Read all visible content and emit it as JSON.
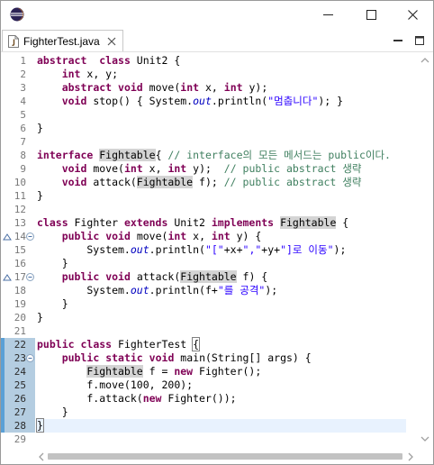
{
  "window": {
    "app_icon": "eclipse-logo-icon",
    "controls": [
      "minimize-icon",
      "maximize-icon",
      "close-icon"
    ]
  },
  "editor_tab": {
    "filename": "FighterTest.java",
    "icon": "java-file-icon",
    "close_icon": "close-icon",
    "right_controls": [
      "minimize-icon",
      "maximize-icon"
    ]
  },
  "colors": {
    "keyword": "#7f0055",
    "comment": "#3f7f5f",
    "string": "#2a00ff",
    "static_field": "#0000c0",
    "occurrence_highlight": "#d4d4d4",
    "current_line": "#e8f2fe",
    "change_ruler": "#b4cde1"
  },
  "lines": [
    {
      "n": "1",
      "tokens": [
        [
          "kw",
          "abstract"
        ],
        [
          "",
          "  "
        ],
        [
          "kw",
          "class"
        ],
        [
          "",
          " Unit2 {"
        ]
      ]
    },
    {
      "n": "2",
      "tokens": [
        [
          "",
          "    "
        ],
        [
          "kw",
          "int"
        ],
        [
          "",
          " x, y;"
        ]
      ]
    },
    {
      "n": "3",
      "tokens": [
        [
          "",
          "    "
        ],
        [
          "kw",
          "abstract"
        ],
        [
          "",
          " "
        ],
        [
          "kw",
          "void"
        ],
        [
          "",
          " move("
        ],
        [
          "kw",
          "int"
        ],
        [
          "",
          " x, "
        ],
        [
          "kw",
          "int"
        ],
        [
          "",
          " y);"
        ]
      ]
    },
    {
      "n": "4",
      "tokens": [
        [
          "",
          "    "
        ],
        [
          "kw",
          "void"
        ],
        [
          "",
          " stop() { System."
        ],
        [
          "fld",
          "out"
        ],
        [
          "",
          ".println("
        ],
        [
          "str",
          "\"멈춥니다\""
        ],
        [
          "",
          "); }"
        ]
      ]
    },
    {
      "n": "5",
      "tokens": []
    },
    {
      "n": "6",
      "tokens": [
        [
          "",
          "}"
        ]
      ]
    },
    {
      "n": "7",
      "tokens": []
    },
    {
      "n": "8",
      "tokens": [
        [
          "kw",
          "interface"
        ],
        [
          "",
          " "
        ],
        [
          "hl",
          "Fightable"
        ],
        [
          "",
          "{ "
        ],
        [
          "cm",
          "// interface의 모든 메서드는 public이다."
        ]
      ]
    },
    {
      "n": "9",
      "tokens": [
        [
          "",
          "    "
        ],
        [
          "kw",
          "void"
        ],
        [
          "",
          " move("
        ],
        [
          "kw",
          "int"
        ],
        [
          "",
          " x, "
        ],
        [
          "kw",
          "int"
        ],
        [
          "",
          " y);  "
        ],
        [
          "cm",
          "// public abstract 생략"
        ]
      ]
    },
    {
      "n": "10",
      "tokens": [
        [
          "",
          "    "
        ],
        [
          "kw",
          "void"
        ],
        [
          "",
          " attack("
        ],
        [
          "hl",
          "Fightable"
        ],
        [
          "",
          " f); "
        ],
        [
          "cm",
          "// public abstract 생략"
        ]
      ]
    },
    {
      "n": "11",
      "tokens": [
        [
          "",
          "}"
        ]
      ]
    },
    {
      "n": "12",
      "tokens": []
    },
    {
      "n": "13",
      "tokens": [
        [
          "kw",
          "class"
        ],
        [
          "",
          " Fighter "
        ],
        [
          "kw",
          "extends"
        ],
        [
          "",
          " Unit2 "
        ],
        [
          "kw",
          "implements"
        ],
        [
          "",
          " "
        ],
        [
          "hl",
          "Fightable"
        ],
        [
          "",
          " {"
        ]
      ]
    },
    {
      "n": "14",
      "tokens": [
        [
          "",
          "    "
        ],
        [
          "kw",
          "public"
        ],
        [
          "",
          " "
        ],
        [
          "kw",
          "void"
        ],
        [
          "",
          " move("
        ],
        [
          "kw",
          "int"
        ],
        [
          "",
          " x, "
        ],
        [
          "kw",
          "int"
        ],
        [
          "",
          " y) {"
        ]
      ]
    },
    {
      "n": "15",
      "tokens": [
        [
          "",
          "        System."
        ],
        [
          "fld",
          "out"
        ],
        [
          "",
          ".println("
        ],
        [
          "str",
          "\"[\""
        ],
        [
          "",
          "+x+"
        ],
        [
          "str",
          "\",\""
        ],
        [
          "",
          "+y+"
        ],
        [
          "str",
          "\"]로 이동\""
        ],
        [
          "",
          ");"
        ]
      ]
    },
    {
      "n": "16",
      "tokens": [
        [
          "",
          "    }"
        ]
      ]
    },
    {
      "n": "17",
      "tokens": [
        [
          "",
          "    "
        ],
        [
          "kw",
          "public"
        ],
        [
          "",
          " "
        ],
        [
          "kw",
          "void"
        ],
        [
          "",
          " attack("
        ],
        [
          "hl",
          "Fightable"
        ],
        [
          "",
          " f) {"
        ]
      ]
    },
    {
      "n": "18",
      "tokens": [
        [
          "",
          "        System."
        ],
        [
          "fld",
          "out"
        ],
        [
          "",
          ".println(f+"
        ],
        [
          "str",
          "\"를 공격\""
        ],
        [
          "",
          ");"
        ]
      ]
    },
    {
      "n": "19",
      "tokens": [
        [
          "",
          "    }"
        ]
      ]
    },
    {
      "n": "20",
      "tokens": [
        [
          "",
          "}"
        ]
      ]
    },
    {
      "n": "21",
      "tokens": []
    },
    {
      "n": "22",
      "tokens": [
        [
          "kw",
          "public"
        ],
        [
          "",
          " "
        ],
        [
          "kw",
          "class"
        ],
        [
          "",
          " FighterTest "
        ],
        [
          "bracket",
          "{"
        ]
      ]
    },
    {
      "n": "23",
      "tokens": [
        [
          "",
          "    "
        ],
        [
          "kw",
          "public"
        ],
        [
          "",
          " "
        ],
        [
          "kw",
          "static"
        ],
        [
          "",
          " "
        ],
        [
          "kw",
          "void"
        ],
        [
          "",
          " main(String[] args) {"
        ]
      ]
    },
    {
      "n": "24",
      "tokens": [
        [
          "",
          "        "
        ],
        [
          "hl",
          "Fightable"
        ],
        [
          "",
          " f = "
        ],
        [
          "kw",
          "new"
        ],
        [
          "",
          " Fighter();"
        ]
      ]
    },
    {
      "n": "25",
      "tokens": [
        [
          "",
          "        f.move(100, 200);"
        ]
      ]
    },
    {
      "n": "26",
      "tokens": [
        [
          "",
          "        f.attack("
        ],
        [
          "kw",
          "new"
        ],
        [
          "",
          " Fighter());"
        ]
      ]
    },
    {
      "n": "27",
      "tokens": [
        [
          "",
          "    }"
        ]
      ]
    },
    {
      "n": "28",
      "tokens": [
        [
          "bracket",
          "}"
        ],
        [
          "caret",
          ""
        ]
      ]
    },
    {
      "n": "29",
      "tokens": []
    }
  ],
  "changed_lines": [
    "22",
    "23",
    "24",
    "25",
    "26",
    "27",
    "28"
  ],
  "current_line": "28",
  "fold_lines": [
    "14",
    "17",
    "23"
  ],
  "override_lines": [
    "14",
    "17"
  ]
}
